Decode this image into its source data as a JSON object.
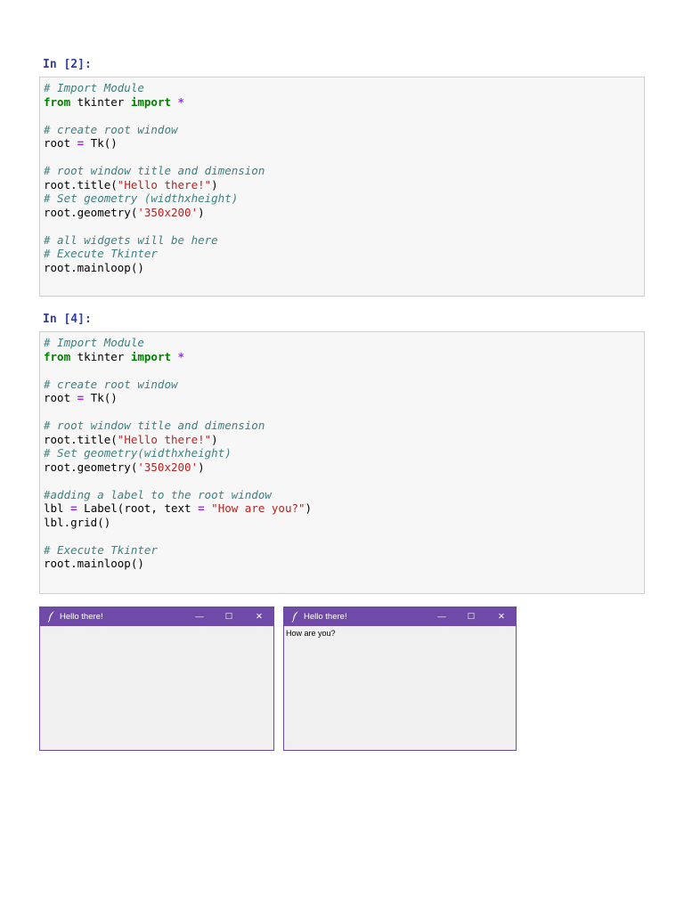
{
  "cells": [
    {
      "prompt": "In [2]:",
      "lines": [
        [
          {
            "t": "# Import Module",
            "c": "c"
          }
        ],
        [
          {
            "t": "from",
            "c": "k"
          },
          {
            "t": " tkinter ",
            "c": "n"
          },
          {
            "t": "import",
            "c": "k"
          },
          {
            "t": " ",
            "c": "n"
          },
          {
            "t": "*",
            "c": "o"
          }
        ],
        [],
        [
          {
            "t": "# create root window",
            "c": "c"
          }
        ],
        [
          {
            "t": "root ",
            "c": "n"
          },
          {
            "t": "=",
            "c": "o"
          },
          {
            "t": " Tk()",
            "c": "n"
          }
        ],
        [],
        [
          {
            "t": "# root window title and dimension",
            "c": "c"
          }
        ],
        [
          {
            "t": "root.title(",
            "c": "n"
          },
          {
            "t": "\"Hello there!\"",
            "c": "s"
          },
          {
            "t": ")",
            "c": "n"
          }
        ],
        [
          {
            "t": "# Set geometry (widthxheight)",
            "c": "c"
          }
        ],
        [
          {
            "t": "root.geometry(",
            "c": "n"
          },
          {
            "t": "'350x200'",
            "c": "s"
          },
          {
            "t": ")",
            "c": "n"
          }
        ],
        [],
        [
          {
            "t": "# all widgets will be here",
            "c": "c"
          }
        ],
        [
          {
            "t": "# Execute Tkinter",
            "c": "c"
          }
        ],
        [
          {
            "t": "root.mainloop()",
            "c": "n"
          }
        ]
      ]
    },
    {
      "prompt": "In [4]:",
      "lines": [
        [
          {
            "t": "# Import Module",
            "c": "c"
          }
        ],
        [
          {
            "t": "from",
            "c": "k"
          },
          {
            "t": " tkinter ",
            "c": "n"
          },
          {
            "t": "import",
            "c": "k"
          },
          {
            "t": " ",
            "c": "n"
          },
          {
            "t": "*",
            "c": "o"
          }
        ],
        [],
        [
          {
            "t": "# create root window",
            "c": "c"
          }
        ],
        [
          {
            "t": "root ",
            "c": "n"
          },
          {
            "t": "=",
            "c": "o"
          },
          {
            "t": " Tk()",
            "c": "n"
          }
        ],
        [],
        [
          {
            "t": "# root window title and dimension",
            "c": "c"
          }
        ],
        [
          {
            "t": "root.title(",
            "c": "n"
          },
          {
            "t": "\"Hello there!\"",
            "c": "s"
          },
          {
            "t": ")",
            "c": "n"
          }
        ],
        [
          {
            "t": "# Set geometry(widthxheight)",
            "c": "c"
          }
        ],
        [
          {
            "t": "root.geometry(",
            "c": "n"
          },
          {
            "t": "'350x200'",
            "c": "s"
          },
          {
            "t": ")",
            "c": "n"
          }
        ],
        [],
        [
          {
            "t": "#adding a label to the root window",
            "c": "c"
          }
        ],
        [
          {
            "t": "lbl ",
            "c": "n"
          },
          {
            "t": "=",
            "c": "o"
          },
          {
            "t": " Label(root, text ",
            "c": "n"
          },
          {
            "t": "=",
            "c": "o"
          },
          {
            "t": " ",
            "c": "n"
          },
          {
            "t": "\"How are you?\"",
            "c": "s"
          },
          {
            "t": ")",
            "c": "n"
          }
        ],
        [
          {
            "t": "lbl.grid()",
            "c": "n"
          }
        ],
        [],
        [
          {
            "t": "# Execute Tkinter",
            "c": "c"
          }
        ],
        [
          {
            "t": "root.mainloop()",
            "c": "n"
          }
        ]
      ]
    }
  ],
  "windows": [
    {
      "title": "Hello there!",
      "label": "",
      "minimize": "—",
      "maximize": "☐",
      "close": "✕"
    },
    {
      "title": "Hello there!",
      "label": "How are you?",
      "minimize": "—",
      "maximize": "☐",
      "close": "✕"
    }
  ],
  "colors": {
    "titlebar": "#6f4aa8",
    "window_bg": "#f0f0f0"
  }
}
